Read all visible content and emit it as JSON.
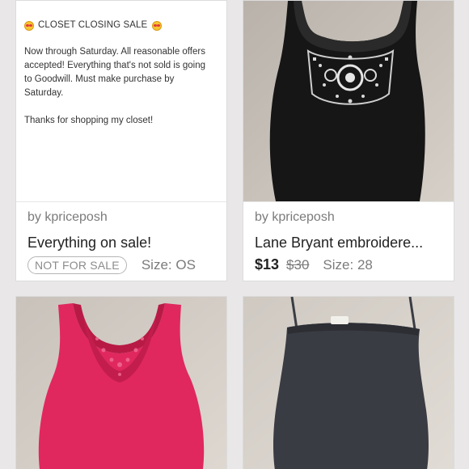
{
  "listings": [
    {
      "note_title": "CLOSET CLOSING SALE",
      "note_body": "Now through Saturday. All reasonable offers accepted! Everything that's not sold is going to Goodwill. Must make purchase by Saturday.",
      "note_footer": "Thanks for shopping my closet!",
      "byline": "by kpriceposh",
      "title": "Everything on sale!",
      "badge": "NOT FOR SALE",
      "size": "Size: OS"
    },
    {
      "byline": "by kpriceposh",
      "title": "Lane Bryant embroidere...",
      "price": "$13",
      "original_price": "$30",
      "size": "Size: 28",
      "image": "black-embroidered-tank-photo"
    },
    {
      "image": "pink-crochet-tank-photo"
    },
    {
      "image": "charcoal-camisole-photo"
    }
  ],
  "colors": {
    "accent_badge_border": "#b5b5b5",
    "background": "#e9e7e8"
  },
  "icons": {
    "emoji": "smiling-face-with-heart-eyes-icon"
  }
}
